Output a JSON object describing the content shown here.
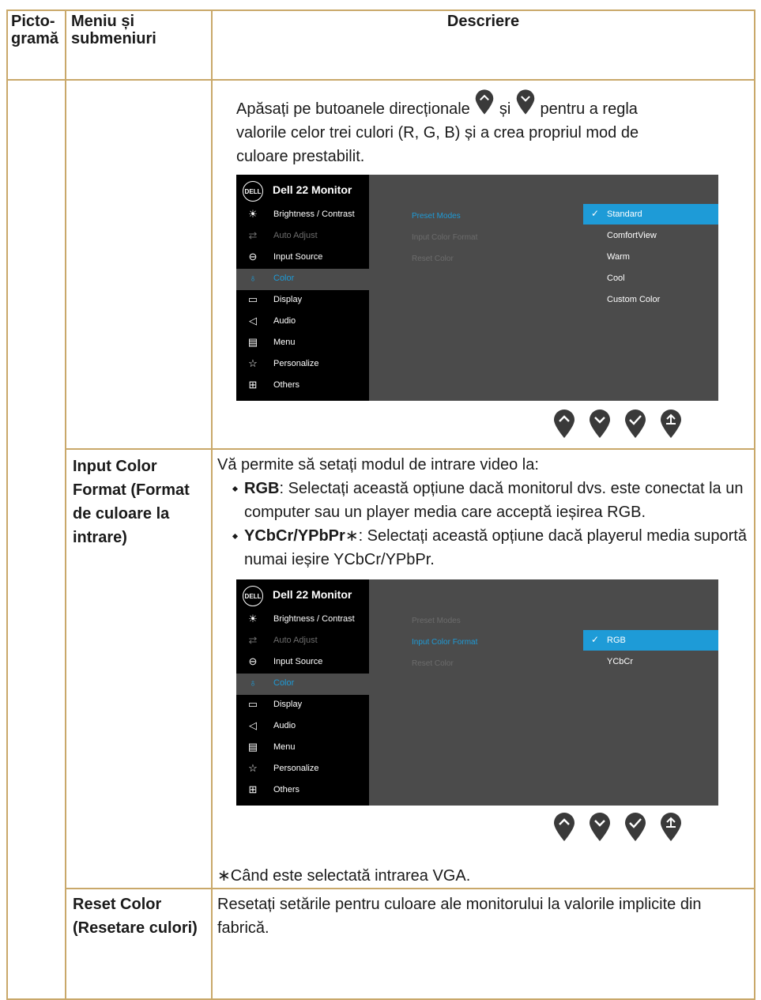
{
  "header": {
    "col1": "Picto-\ngramă",
    "col2": "Meniu și\nsubmeniuri",
    "col3": "Descriere"
  },
  "row1": {
    "text_before": "Apăsați pe butoanele direcționale",
    "text_and": "și",
    "text_after": "pentru a regla",
    "line2": "valorile celor trei culori (R, G, B) și a crea propriul mod de",
    "line3": "culoare prestabilit."
  },
  "osd1": {
    "logo": "DELL",
    "title": "Dell 22 Monitor",
    "menu": [
      {
        "label": "Brightness / Contrast",
        "icon": "brightness-icon",
        "state": "normal"
      },
      {
        "label": "Auto Adjust",
        "icon": "auto-adjust-icon",
        "state": "dim"
      },
      {
        "label": "Input Source",
        "icon": "input-source-icon",
        "state": "normal"
      },
      {
        "label": "Color",
        "icon": "color-icon",
        "state": "selected"
      },
      {
        "label": "Display",
        "icon": "display-icon",
        "state": "normal"
      },
      {
        "label": "Audio",
        "icon": "audio-icon",
        "state": "normal"
      },
      {
        "label": "Menu",
        "icon": "menu-icon",
        "state": "normal"
      },
      {
        "label": "Personalize",
        "icon": "star-icon",
        "state": "normal"
      },
      {
        "label": "Others",
        "icon": "others-icon",
        "state": "normal"
      }
    ],
    "submenu": [
      "Preset Modes",
      "Input Color Format",
      "Reset Color"
    ],
    "submenu_selected": 0,
    "options": [
      "Standard",
      "ComfortView",
      "Warm",
      "Cool",
      "Custom Color"
    ],
    "option_selected": 0
  },
  "row2": {
    "menu_label": "Input Color Format (Format de culoare la intrare)",
    "intro": "Vă permite să setați modul de intrare video la:",
    "b1_bold": "RGB",
    "b1_text": ": Selectați această opțiune dacă monitorul dvs. este conectat la un computer sau un player media care acceptă ieșirea RGB.",
    "b2_bold": "YCbCr/YPbPr",
    "b2_text": "∗: Selectați această opțiune dacă playerul media suportă numai ieșire YCbCr/YPbPr.",
    "footnote": "∗Când este selectată intrarea VGA."
  },
  "osd2": {
    "logo": "DELL",
    "title": "Dell 22 Monitor",
    "submenu": [
      "Preset Modes",
      "Input Color Format",
      "Reset Color"
    ],
    "submenu_selected": 1,
    "options": [
      "RGB",
      "YCbCr"
    ],
    "option_selected": 0
  },
  "row3": {
    "menu_label": "Reset Color (Resetare culori)",
    "text": "Resetați setările pentru culoare ale monitorului la valorile implicite din fabrică."
  },
  "buttons": [
    "up-button-icon",
    "down-button-icon",
    "check-button-icon",
    "back-button-icon"
  ],
  "colors": {
    "border": "#c9a86a",
    "accent": "#1e9bd7",
    "osd_bg": "#4b4b4b",
    "pin": "#3a3a3a"
  }
}
